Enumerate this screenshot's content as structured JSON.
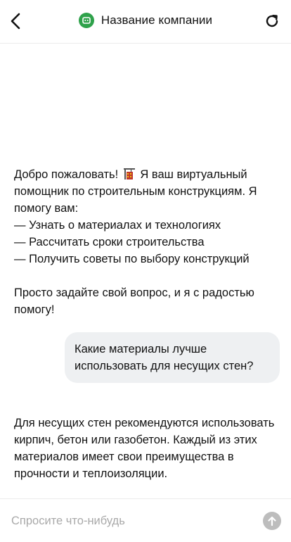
{
  "header": {
    "company_name": "Название компании",
    "icons": {
      "back": "chevron-left-icon",
      "logo": "bot-icon",
      "refresh": "refresh-icon"
    },
    "logo_color": "#2fa24b"
  },
  "messages": [
    {
      "role": "assistant",
      "text_before_emoji": "Добро пожаловать! ",
      "emoji": "construction-icon",
      "text_after_emoji": " Я ваш виртуальный помощник по строительным конструкциям. Я помогу вам:\n— Узнать о материалах и технологиях\n— Рассчитать сроки строительства\n— Получить советы по выбору конструкций\n\nПросто задайте свой вопрос, и я с радостью помогу!"
    },
    {
      "role": "user",
      "text": "Какие материалы лучше использовать для несущих стен?"
    },
    {
      "role": "assistant",
      "text": "Для несущих стен рекомендуются использовать кирпич, бетон или газобетон. Каждый из этих материалов имеет свои преимущества в прочности и теплоизоляции."
    }
  ],
  "input": {
    "placeholder": "Спросите что-нибудь",
    "value": "",
    "send_icon": "arrow-up-icon",
    "send_color": "#bdbdbd"
  }
}
